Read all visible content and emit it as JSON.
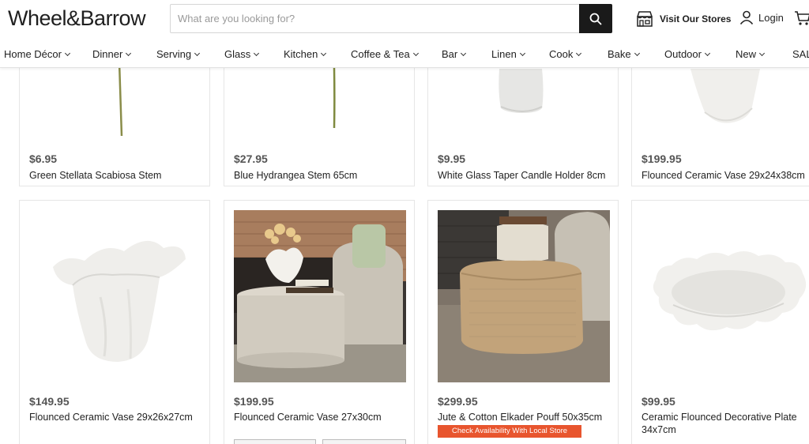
{
  "header": {
    "logo": "Wheel&Barrow",
    "search_placeholder": "What are you looking for?",
    "stores_label": "Visit Our Stores",
    "login_label": "Login"
  },
  "nav": {
    "items": [
      "Home Décor",
      "Dinner",
      "Serving",
      "Glass",
      "Kitchen",
      "Coffee & Tea",
      "Bar",
      "Linen",
      "Cook",
      "Bake",
      "Outdoor",
      "New",
      "SALE"
    ]
  },
  "products": [
    {
      "price": "$6.95",
      "name": "Green Stellata Scabiosa Stem"
    },
    {
      "price": "$27.95",
      "name": "Blue Hydrangea Stem 65cm"
    },
    {
      "price": "$9.95",
      "name": "White Glass Taper Candle Holder 8cm"
    },
    {
      "price": "$199.95",
      "name": "Flounced Ceramic Vase 29x24x38cm"
    },
    {
      "price": "$149.95",
      "name": "Flounced Ceramic Vase 29x26x27cm"
    },
    {
      "price": "$199.95",
      "name": "Flounced Ceramic Vase 27x30cm"
    },
    {
      "price": "$299.95",
      "name": "Jute & Cotton Elkader Pouff 50x35cm",
      "badge": "Check Availability With Local Store"
    },
    {
      "price": "$99.95",
      "name": "Ceramic Flounced Decorative Plate 34x7cm"
    }
  ],
  "colors": {
    "badge": "#e8552e",
    "search_button": "#1a1a1a"
  }
}
